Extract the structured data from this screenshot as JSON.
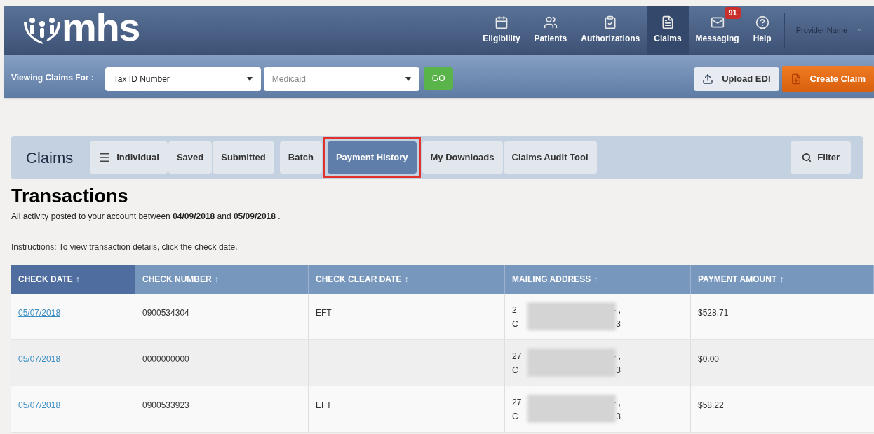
{
  "header": {
    "logo_text": "mhs",
    "nav": [
      {
        "label": "Eligibility",
        "selected": false
      },
      {
        "label": "Patients",
        "selected": false
      },
      {
        "label": "Authorizations",
        "selected": false
      },
      {
        "label": "Claims",
        "selected": true
      },
      {
        "label": "Messaging",
        "selected": false,
        "badge": "91"
      },
      {
        "label": "Help",
        "selected": false
      }
    ],
    "provider": "Provider Name"
  },
  "subbar": {
    "label": "Viewing Claims For :",
    "selects": [
      {
        "value": "Tax ID Number"
      },
      {
        "value": "Medicaid"
      }
    ],
    "go": "GO",
    "upload": "Upload EDI",
    "create": "Create Claim"
  },
  "claims_bar": {
    "title": "Claims",
    "groups": [
      [
        {
          "label": "Individual",
          "kind": "menu",
          "selected": false,
          "highlighted": false
        },
        {
          "label": "Saved",
          "selected": false,
          "highlighted": false
        },
        {
          "label": "Submitted",
          "selected": false,
          "highlighted": false
        }
      ],
      [
        {
          "label": "Batch",
          "selected": false,
          "highlighted": false
        }
      ],
      [
        {
          "label": "Payment History",
          "selected": true,
          "highlighted": true
        }
      ],
      [
        {
          "label": "My Downloads",
          "selected": false,
          "highlighted": false
        },
        {
          "label": "Claims Audit Tool",
          "selected": false,
          "highlighted": false
        }
      ]
    ],
    "filter": "Filter"
  },
  "heading": "Transactions",
  "summary": "All activity posted to your account between **04/09/2018** and **05/09/2018** .",
  "instructions": "Instructions: To view transaction details, click the check date.",
  "table": {
    "columns": [
      {
        "label": "CHECK DATE",
        "arrow": "↑",
        "sorted": true
      },
      {
        "label": "CHECK NUMBER",
        "arrow": "↕",
        "sorted": false
      },
      {
        "label": "CHECK CLEAR DATE",
        "arrow": "↕",
        "sorted": false
      },
      {
        "label": "MAILING ADDRESS",
        "arrow": "↕",
        "sorted": false
      },
      {
        "label": "PAYMENT AMOUNT",
        "arrow": "↕",
        "sorted": false
      }
    ],
    "rows": [
      {
        "check_date": "05/07/2018",
        "check_number": "0900534304",
        "clear_date": "EFT",
        "address": {
          "line_1_start": "2",
          "line_1_end": "- ,",
          "line_2_start": "C",
          "line_2_end": "3"
        },
        "amount": "$528.71"
      },
      {
        "check_date": "05/07/2018",
        "check_number": "0000000000",
        "address": {
          "line_1_start": "27",
          "line_1_end": "- ,",
          "line_2_start": "C",
          "line_2_end": "3"
        },
        "amount": "$0.00"
      },
      {
        "check_date": "05/07/2018",
        "check_number": "0900533923",
        "clear_date": "EFT",
        "address": {
          "line_1_start": "27",
          "line_1_end": "- ,",
          "line_2_start": "C",
          "line_2_end": "3"
        },
        "amount": "$58.22"
      }
    ]
  }
}
